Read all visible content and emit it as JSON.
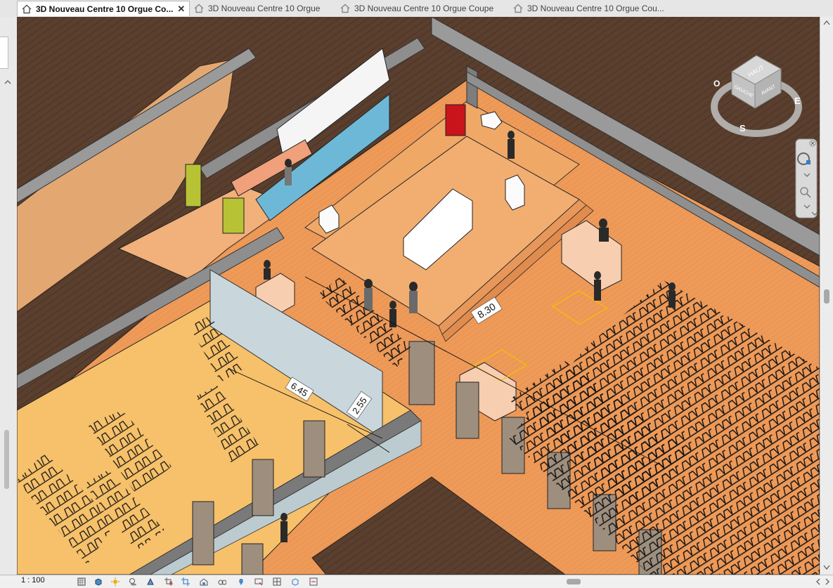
{
  "tabs": [
    {
      "label": "3D Nouveau Centre 10 Orgue Co...",
      "active": true,
      "closable": true
    },
    {
      "label": "3D Nouveau Centre 10 Orgue",
      "active": false
    },
    {
      "label": "3D Nouveau Centre 10 Orgue Coupe",
      "active": false
    },
    {
      "label": "3D Nouveau Centre 10 Orgue Cou...",
      "active": false
    }
  ],
  "close_glyph": "✕",
  "view": {
    "dimensions": [
      "8.30",
      "6.45",
      "2.55"
    ]
  },
  "viewcube": {
    "face_top": "HAUT",
    "face_front": "AVANT",
    "face_left": "GAUCHE",
    "compass": {
      "east": "E",
      "south": "S",
      "west": "O"
    }
  },
  "status": {
    "scale": "1 : 100"
  },
  "colors": {
    "floor_orange": "#f2a35f",
    "floor_yellow": "#f6c16a",
    "floor_dark": "#4b3426",
    "wall_grey": "#8c8c8c",
    "glass_blue": "#6db8d6"
  }
}
